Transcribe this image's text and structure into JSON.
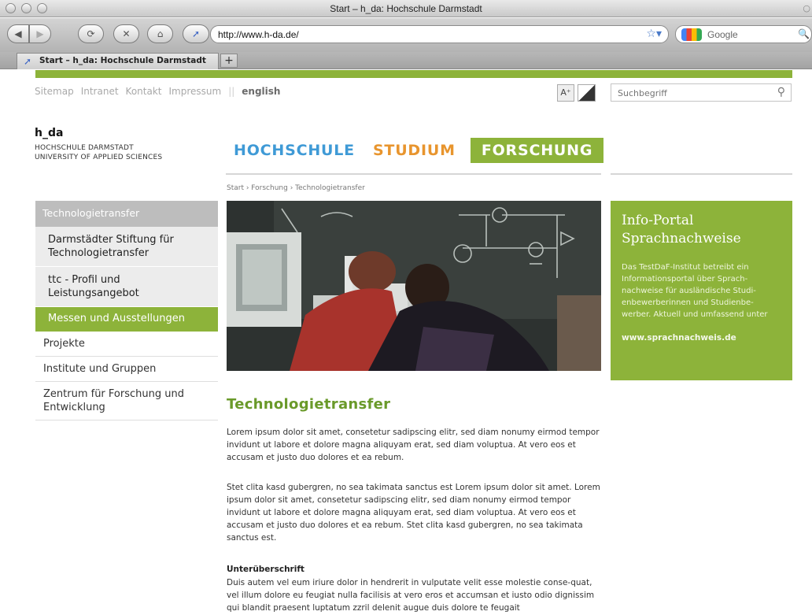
{
  "window": {
    "title": "Start – h_da: Hochschule Darmstadt"
  },
  "toolbar": {
    "url": "http://www.h-da.de/",
    "search_engine": "Google"
  },
  "tab": {
    "label": "Start – h_da: Hochschule Darmstadt",
    "new_tab": "+"
  },
  "meta_nav": {
    "items": [
      "Sitemap",
      "Intranet",
      "Kontakt",
      "Impressum"
    ],
    "separator": "||",
    "language": "english",
    "font_size_button": "A⁺",
    "search_placeholder": "Suchbegriff"
  },
  "logo": {
    "name": "h_da",
    "line1": "HOCHSCHULE DARMSTADT",
    "line2": "UNIVERSITY OF APPLIED SCIENCES"
  },
  "main_nav": {
    "hochschule": "HOCHSCHULE",
    "studium": "STUDIUM",
    "forschung": "FORSCHUNG"
  },
  "breadcrumb": "Start › Forschung › Technologietransfer",
  "sidebar": {
    "header": "Technologietransfer",
    "sub1": "Darmstädter Stiftung für Technologietransfer",
    "sub2": "ttc - Profil und Leistungsangebot",
    "active": "Messen und Ausstellungen",
    "item1": "Projekte",
    "item2": "Institute und Gruppen",
    "item3": "Zentrum für Forschung und Entwicklung"
  },
  "info_box": {
    "title": "Info-Portal Sprachnachweise",
    "text": "Das TestDaF-Institut betreibt ein Informationsportal über Sprach-nachweise für ausländische Studi-enbewerberinnen und Studienbe-werber. Aktuell und umfassend unter",
    "link": "www.sprachnachweis.de"
  },
  "content": {
    "heading": "Technologietransfer",
    "para1": "Lorem ipsum dolor sit amet, consetetur sadipscing elitr, sed diam nonumy eirmod tempor invidunt ut labore et dolore magna aliquyam erat, sed diam voluptua. At vero eos et accusam et justo duo dolores et ea rebum.",
    "para2": "Stet clita kasd gubergren, no sea takimata sanctus est Lorem ipsum dolor sit amet. Lorem ipsum dolor sit amet, consetetur sadipscing elitr, sed diam nonumy eirmod tempor invidunt ut labore et dolore magna aliquyam erat, sed diam voluptua. At vero eos et accusam et justo duo dolores et ea rebum. Stet clita kasd gubergren, no sea takimata sanctus est.",
    "subheading": "Unterüberschrift",
    "para3": "Duis autem vel eum iriure dolor in hendrerit in vulputate velit esse molestie conse-quat, vel illum dolore eu feugiat nulla facilisis at vero eros et accumsan et iusto odio dignissim qui blandit praesent luptatum zzril delenit augue duis dolore te feugait"
  },
  "colors": {
    "brand_green": "#8db33a",
    "hochschule_blue": "#3f9ad6",
    "studium_orange": "#e8952e"
  }
}
